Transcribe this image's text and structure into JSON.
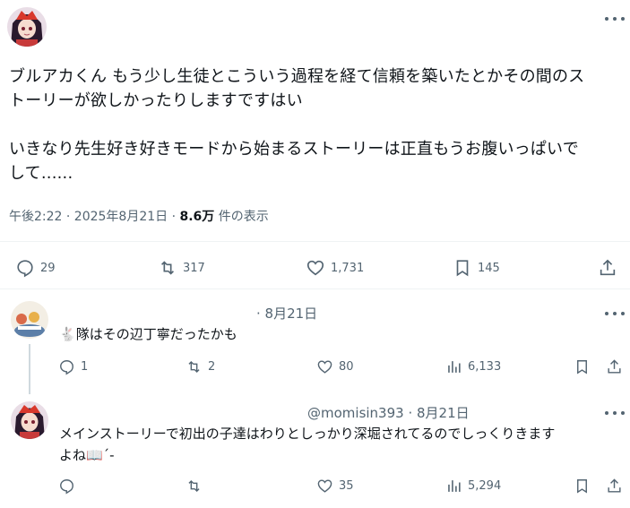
{
  "main": {
    "text_line1": "ブルアカくん もう少し生徒とこういう過程を経て信頼を築いたとかその間のス",
    "text_line2": "トーリーが欲しかったりしますですはい",
    "text_line3": "いきなり先生好き好きモードから始まるストーリーは正直もうお腹いっぱいで",
    "text_line4": "して......",
    "time": "午後2:22 · 2025年8月21日 ·",
    "views_count": "8.6万",
    "views_label": "件の表示",
    "actions": {
      "reply": "29",
      "retweet": "317",
      "like": "1,731",
      "bookmark": "145"
    }
  },
  "reply1": {
    "date": "· 8月21日",
    "emoji": "🐇",
    "text": "隊はその辺丁寧だったかも",
    "actions": {
      "reply": "1",
      "retweet": "2",
      "like": "80",
      "views": "6,133"
    }
  },
  "reply2": {
    "handle_date": "@momisin393 · 8月21日",
    "text_line1": "メインストーリーで初出の子達はわりとしっかり深堀されてるのでしっくりきます",
    "text_line2": "よね📖´-",
    "actions": {
      "like": "35",
      "views": "5,294"
    }
  },
  "colors": {
    "icon_gray": "#536471",
    "divider": "#eff3f4",
    "text": "#0f1419"
  }
}
